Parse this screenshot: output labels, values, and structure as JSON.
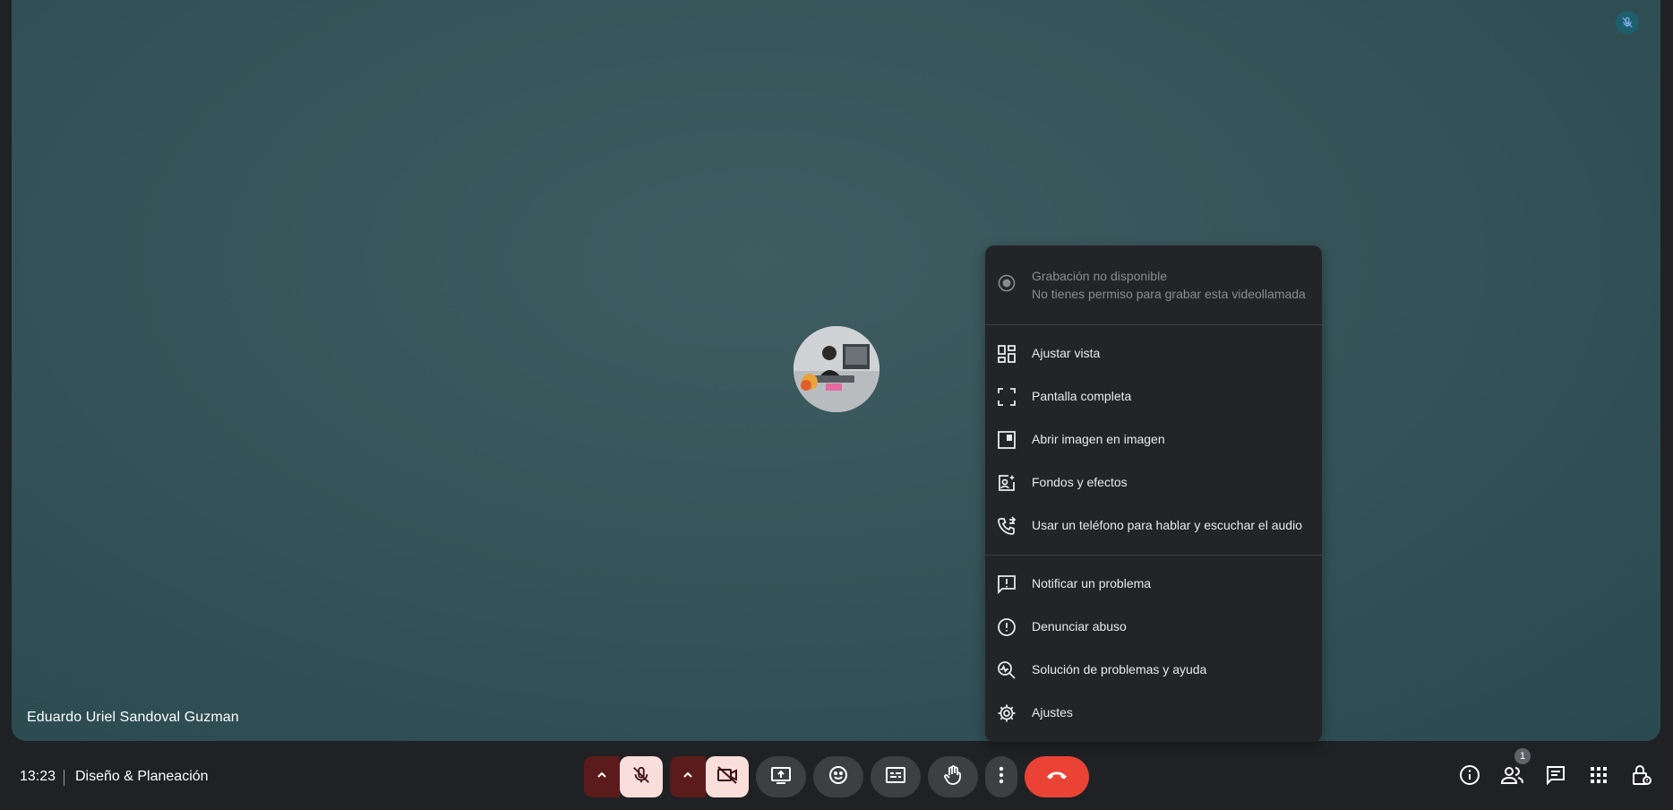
{
  "stage": {
    "participant_name": "Eduardo Uriel Sandoval Guzman",
    "mic_status_icon": "mic-off-icon"
  },
  "menu": {
    "recording": {
      "title": "Grabación no disponible",
      "subtitle": "No tienes permiso para grabar esta videollamada"
    },
    "items": [
      {
        "label": "Ajustar vista",
        "icon": "layout-icon"
      },
      {
        "label": "Pantalla completa",
        "icon": "fullscreen-icon"
      },
      {
        "label": "Abrir imagen en imagen",
        "icon": "picture-in-picture-icon"
      },
      {
        "label": "Fondos y efectos",
        "icon": "background-effects-icon"
      },
      {
        "label": "Usar un teléfono para hablar y escuchar el audio",
        "icon": "phone-forward-icon"
      },
      {
        "label": "Notificar un problema",
        "icon": "feedback-icon"
      },
      {
        "label": "Denunciar abuso",
        "icon": "report-icon"
      },
      {
        "label": "Solución de problemas y ayuda",
        "icon": "troubleshoot-icon"
      },
      {
        "label": "Ajustes",
        "icon": "gear-icon"
      }
    ]
  },
  "bottom": {
    "time": "13:23",
    "meeting_title": "Diseño & Planeación",
    "people_count": "1"
  },
  "colors": {
    "end_call": "#ea4335",
    "muted_bg": "#f9dedc",
    "muted_caret": "#5c1b1b",
    "menu_bg": "#232427"
  }
}
